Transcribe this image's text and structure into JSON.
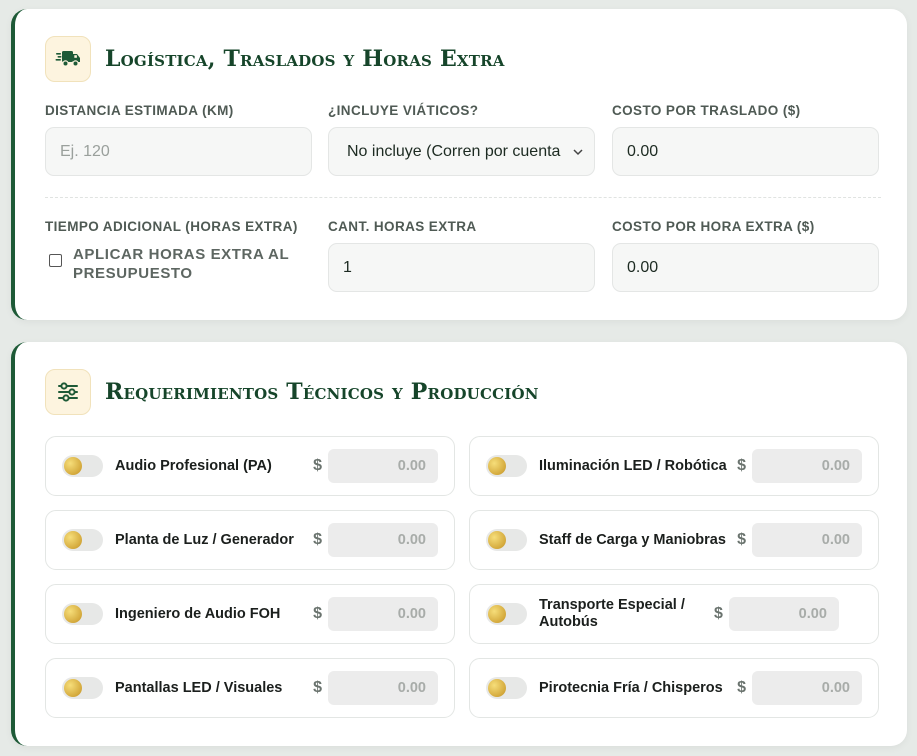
{
  "logistics": {
    "icon": "truck-fast-icon",
    "title": "Logística, Traslados y Horas Extra",
    "distance": {
      "label": "DISTANCIA ESTIMADA (KM)",
      "placeholder": "Ej. 120",
      "value": ""
    },
    "viaticos": {
      "label": "¿INCLUYE VIÁTICOS?",
      "selected": "No incluye (Corren por cuenta"
    },
    "trip_cost": {
      "label": "COSTO POR TRASLADO ($)",
      "value": "0.00"
    },
    "extra_time": {
      "label": "TIEMPO ADICIONAL (HORAS EXTRA)",
      "checkbox_label": "APLICAR HORAS EXTRA AL PRESUPUESTO",
      "checked": false
    },
    "extra_hours": {
      "label": "CANT. HORAS EXTRA",
      "value": "1"
    },
    "extra_hour_cost": {
      "label": "COSTO POR HORA EXTRA ($)",
      "value": "0.00"
    }
  },
  "requirements": {
    "icon": "sliders-icon",
    "title": "Requerimientos Técnicos y Producción",
    "currency_symbol": "$",
    "items": [
      {
        "label": "Audio Profesional (PA)",
        "value": "0.00",
        "enabled": false
      },
      {
        "label": "Iluminación LED / Robótica",
        "value": "0.00",
        "enabled": false
      },
      {
        "label": "Planta de Luz / Generador",
        "value": "0.00",
        "enabled": false
      },
      {
        "label": "Staff de Carga y Maniobras",
        "value": "0.00",
        "enabled": false
      },
      {
        "label": "Ingeniero de Audio FOH",
        "value": "0.00",
        "enabled": false
      },
      {
        "label": "Transporte Especial / Autobús",
        "value": "0.00",
        "enabled": false
      },
      {
        "label": "Pantallas LED / Visuales",
        "value": "0.00",
        "enabled": false
      },
      {
        "label": "Pirotecnia Fría / Chisperos",
        "value": "0.00",
        "enabled": false
      }
    ]
  },
  "colors": {
    "accent_green": "#1e5a37",
    "title_green": "#16452a",
    "icon_bg": "#fdf4df",
    "toggle_gold": "#d4a93c"
  }
}
